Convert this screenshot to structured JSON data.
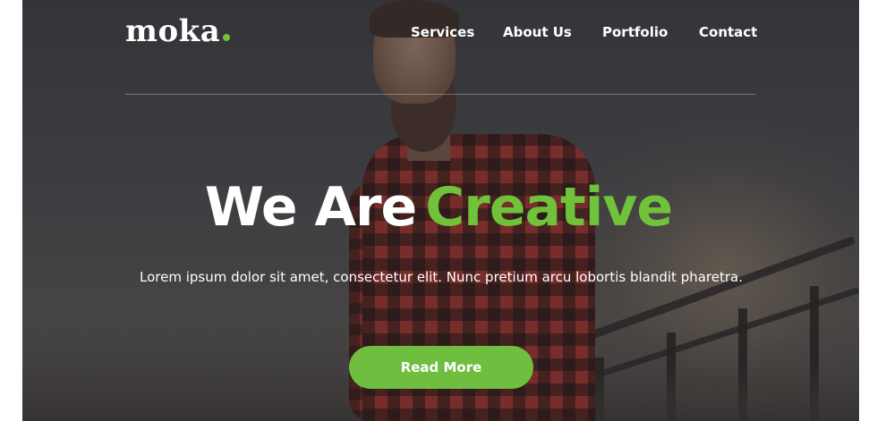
{
  "brand": {
    "logo_text": "moka",
    "accent_color": "#6fc23a"
  },
  "nav": {
    "items": [
      {
        "label": "Services"
      },
      {
        "label": "About Us"
      },
      {
        "label": "Portfolio"
      },
      {
        "label": "Contact"
      }
    ]
  },
  "hero": {
    "headline_white": "We Are",
    "headline_green": "Creative",
    "subtext": "Lorem ipsum dolor sit amet, consectetur elit. Nunc pretium arcu lobortis blandit pharetra.",
    "cta_label": "Read More",
    "cta_color": "#6fbe3f"
  }
}
